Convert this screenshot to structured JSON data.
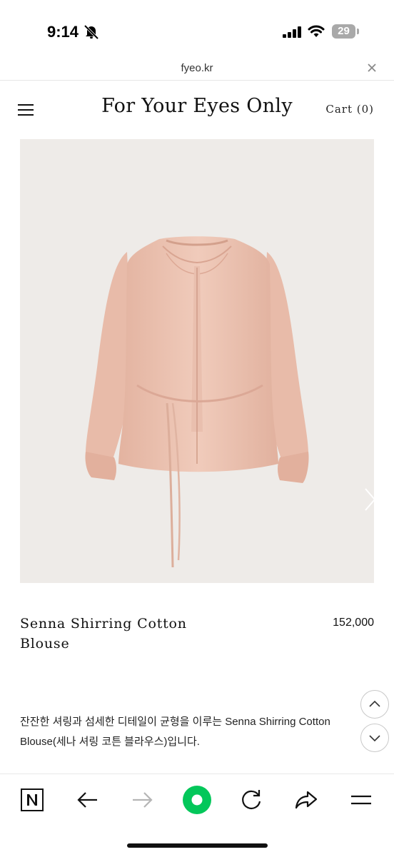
{
  "status": {
    "time": "9:14",
    "battery": "29"
  },
  "browser": {
    "url": "fyeo.kr"
  },
  "header": {
    "logo": "For Your Eyes Only",
    "cart": "Cart (0)"
  },
  "product": {
    "name": "Senna Shirring Cotton Blouse",
    "price": "152,000",
    "description": "잔잔한 셔링과 섬세한 디테일이 균형을 이루는 Senna Shirring Cotton Blouse(세나 셔링 코튼 블라우스)입니다."
  },
  "icons": {
    "menu": "menu-icon",
    "close": "close-icon",
    "next": "chevron-right-icon",
    "scroll_up": "chevron-up-icon",
    "scroll_down": "chevron-down-icon",
    "naver": "naver-n-icon",
    "back": "arrow-left-icon",
    "forward": "arrow-right-icon",
    "green_dot": "green-circle-icon",
    "reload": "reload-icon",
    "share": "share-icon",
    "more": "menu-lines-icon"
  },
  "colors": {
    "accent_green": "#03c75a",
    "image_bg": "#eeebe8",
    "blouse": "#ecc3b2"
  }
}
